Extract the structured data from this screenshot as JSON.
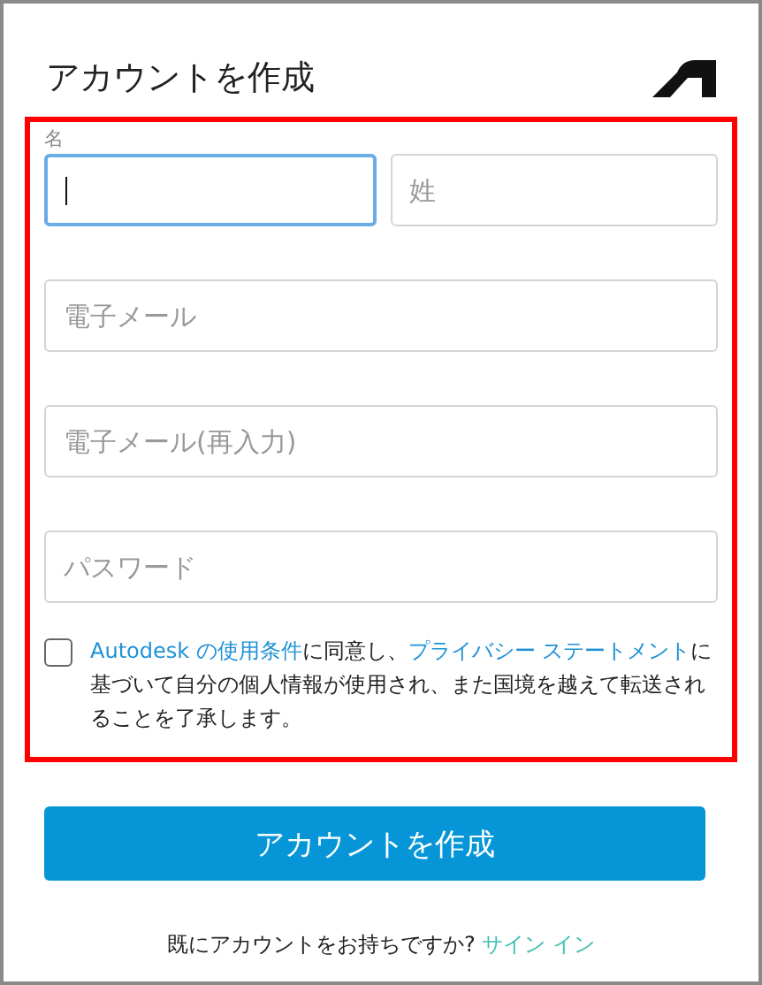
{
  "header": {
    "title": "アカウントを作成"
  },
  "name_label": "名",
  "name_fields": [
    {
      "focused": true
    },
    {
      "placeholder": "姓",
      "focused": false
    }
  ],
  "fields": [
    {
      "placeholder": "電子メール"
    },
    {
      "placeholder": "電子メール(再入力)"
    },
    {
      "placeholder": "パスワード"
    }
  ],
  "consent": {
    "checked": false,
    "parts": [
      {
        "kind": "link",
        "text": "Autodesk の使用条件"
      },
      {
        "kind": "text",
        "text": "に同意し、"
      },
      {
        "kind": "link",
        "text": "プライバシー ステートメント"
      },
      {
        "kind": "text",
        "text": "に基づいて自分の個人情報が使用され、また国境を越えて転送されることを了承します。"
      }
    ]
  },
  "submit_button": "アカウントを作成",
  "signin": {
    "prompt": "既にアカウントをお持ちですか?",
    "link": "サイン イン"
  }
}
